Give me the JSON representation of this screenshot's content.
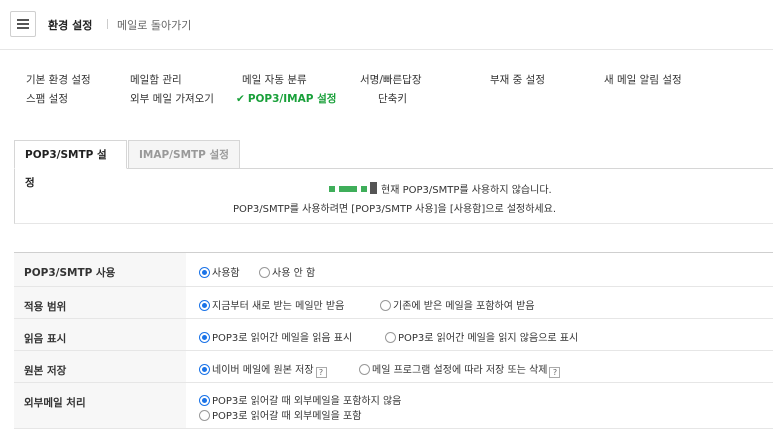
{
  "header": {
    "title": "환경 설정",
    "back_link": "메일로 돌아가기"
  },
  "nav": {
    "items": [
      {
        "label": "기본 환경 설정"
      },
      {
        "label": "메일함 관리"
      },
      {
        "label": "메일 자동 분류"
      },
      {
        "label": "서명/빠른답장"
      },
      {
        "label": "부재 중 설정"
      },
      {
        "label": "새 메일 알림 설정"
      },
      {
        "label": "스팸 설정"
      },
      {
        "label": "외부 메일 가져오기"
      },
      {
        "label": "POP3/IMAP 설정",
        "active": true
      },
      {
        "label": "단축키"
      }
    ]
  },
  "tabs": [
    {
      "label": "POP3/SMTP 설정",
      "active": true
    },
    {
      "label": "IMAP/SMTP 설정",
      "active": false
    }
  ],
  "notice": {
    "line1": "현재 POP3/SMTP를 사용하지 않습니다.",
    "line2": "POP3/SMTP를 사용하려면 [POP3/SMTP 사용]을 [사용함]으로 설정하세요."
  },
  "settings": {
    "rows": [
      {
        "label": "POP3/SMTP 사용",
        "options": [
          "사용함",
          "사용 안 함"
        ],
        "selected": 0
      },
      {
        "label": "적용 범위",
        "options": [
          "지금부터 새로 받는 메일만 받음",
          "기존에 받은 메일을 포함하여 받음"
        ],
        "selected": 0
      },
      {
        "label": "읽음 표시",
        "options": [
          "POP3로 읽어간 메일을 읽음 표시",
          "POP3로 읽어간 메일을 읽지 않음으로 표시"
        ],
        "selected": 0
      },
      {
        "label": "원본 저장",
        "options": [
          "네이버 메일에 원본 저장",
          "메일 프로그램 설정에 따라 저장 또는 삭제"
        ],
        "selected": 0,
        "help_glyph": "?"
      },
      {
        "label": "외부메일 처리",
        "options": [
          "POP3로 읽어갈 때 외부메일을 포함하지 않음",
          "POP3로 읽어갈 때 외부메일을 포함"
        ],
        "selected": 0
      }
    ]
  },
  "colors": {
    "accent_green": "#19a03a",
    "radio_blue": "#1a73e8"
  }
}
